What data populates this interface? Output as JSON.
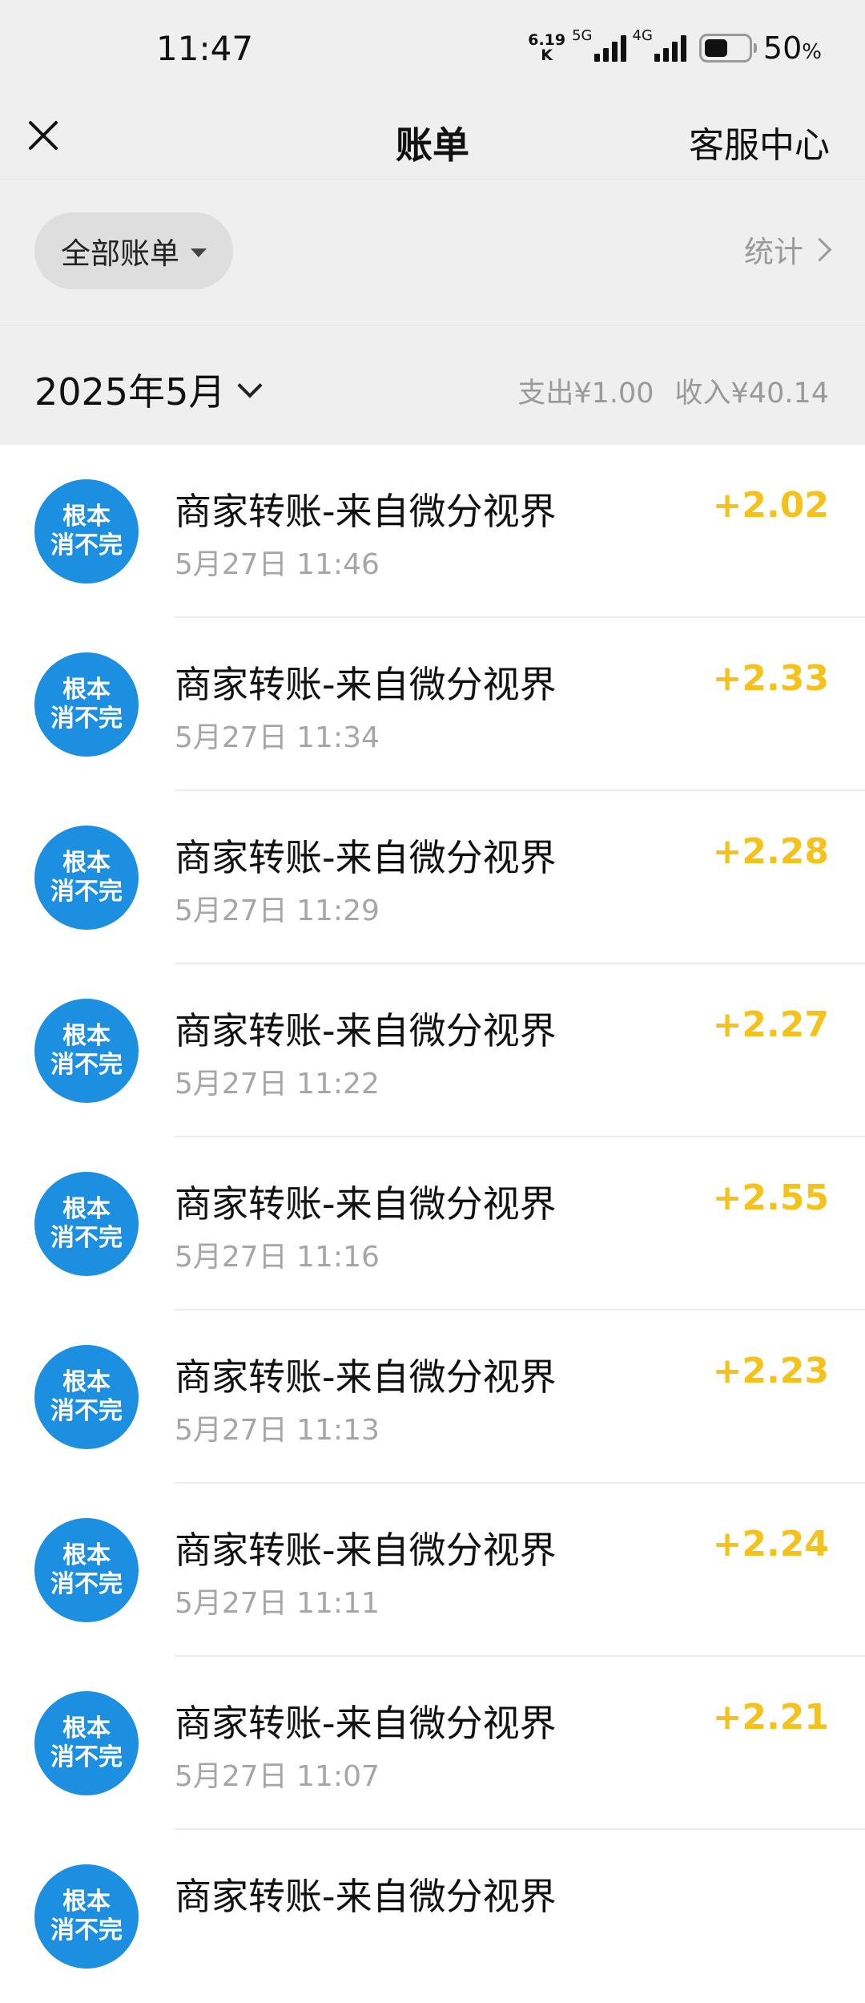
{
  "status_bar": {
    "time": "11:47",
    "net_speed_value": "6.19",
    "net_speed_unit": "K",
    "signal1_label": "5G",
    "signal2_label": "4G",
    "battery_percent": "50",
    "battery_unit": "%"
  },
  "header": {
    "title": "账单",
    "service_label": "客服中心"
  },
  "filter": {
    "label": "全部账单",
    "stats_label": "统计"
  },
  "month": {
    "label": "2025年5月",
    "expense": "支出¥1.00",
    "income": "收入¥40.14"
  },
  "avatar_text": {
    "line1": "根本",
    "line2": "消不完"
  },
  "transactions": [
    {
      "title": "商家转账-来自微分视界",
      "time": "5月27日 11:46",
      "amount": "+2.02"
    },
    {
      "title": "商家转账-来自微分视界",
      "time": "5月27日 11:34",
      "amount": "+2.33"
    },
    {
      "title": "商家转账-来自微分视界",
      "time": "5月27日 11:29",
      "amount": "+2.28"
    },
    {
      "title": "商家转账-来自微分视界",
      "time": "5月27日 11:22",
      "amount": "+2.27"
    },
    {
      "title": "商家转账-来自微分视界",
      "time": "5月27日 11:16",
      "amount": "+2.55"
    },
    {
      "title": "商家转账-来自微分视界",
      "time": "5月27日 11:13",
      "amount": "+2.23"
    },
    {
      "title": "商家转账-来自微分视界",
      "time": "5月27日 11:11",
      "amount": "+2.24"
    },
    {
      "title": "商家转账-来自微分视界",
      "time": "5月27日 11:07",
      "amount": "+2.21"
    },
    {
      "title": "商家转账-来自微分视界",
      "time": "",
      "amount": ""
    }
  ],
  "colors": {
    "amount": "#f5c21b",
    "avatar": "#1d8fe1",
    "header_bg": "#efefef"
  }
}
